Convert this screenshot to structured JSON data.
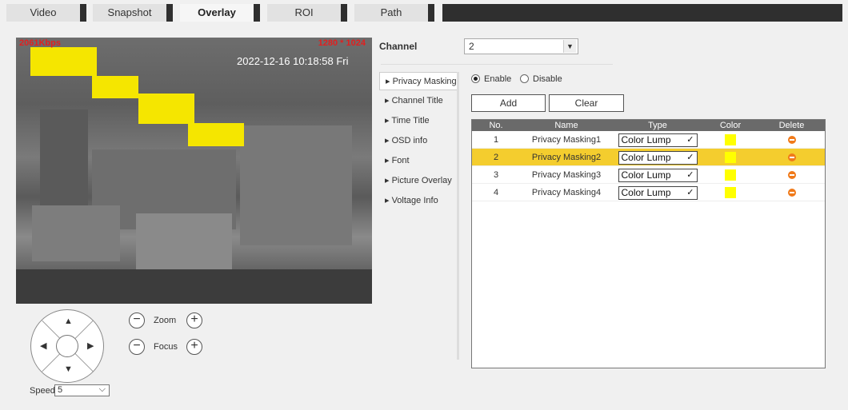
{
  "tabs": [
    {
      "label": "Video"
    },
    {
      "label": "Snapshot"
    },
    {
      "label": "Overlay"
    },
    {
      "label": "ROI"
    },
    {
      "label": "Path"
    }
  ],
  "active_tab": "Overlay",
  "video": {
    "bitrate": "2061Kbps",
    "resolution": "1280 * 1024",
    "osd_time": "2022-12-16 10:18:58 Fri"
  },
  "ptz": {
    "zoom_label": "Zoom",
    "focus_label": "Focus",
    "speed_label": "Speed",
    "speed_value": "5",
    "minus": "−",
    "plus": "+"
  },
  "channel": {
    "label": "Channel",
    "value": "2"
  },
  "menu": [
    {
      "label": "Privacy Masking"
    },
    {
      "label": "Channel Title"
    },
    {
      "label": "Time Title"
    },
    {
      "label": "OSD info"
    },
    {
      "label": "Font"
    },
    {
      "label": "Picture Overlay"
    },
    {
      "label": "Voltage Info"
    }
  ],
  "menu_active": "Privacy Masking",
  "enable": {
    "enable_label": "Enable",
    "disable_label": "Disable",
    "selected": "Enable"
  },
  "buttons": {
    "add": "Add",
    "clear": "Clear"
  },
  "table": {
    "headers": [
      "No.",
      "Name",
      "Type",
      "Color",
      "Delete"
    ],
    "rows": [
      {
        "no": "1",
        "name": "Privacy Masking1",
        "type": "Color Lump",
        "color": "#ffff00"
      },
      {
        "no": "2",
        "name": "Privacy Masking2",
        "type": "Color Lump",
        "color": "#ffff00",
        "selected": true
      },
      {
        "no": "3",
        "name": "Privacy Masking3",
        "type": "Color Lump",
        "color": "#ffff00"
      },
      {
        "no": "4",
        "name": "Privacy Masking4",
        "type": "Color Lump",
        "color": "#ffff00"
      }
    ]
  },
  "colors": {
    "mask": "#f5e600",
    "selected_row": "#f4cd2e",
    "delete": "#f07a1a",
    "header": "#6a6a6a"
  }
}
